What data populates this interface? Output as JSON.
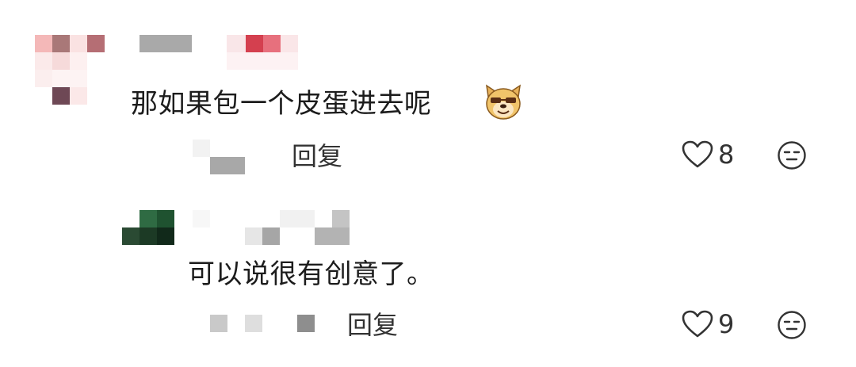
{
  "comments": [
    {
      "text": "那如果包一个皮蛋进去呢",
      "emoji_icon": "doge-sunglasses-emoji-icon",
      "reply_label": "回复",
      "like_count": "8",
      "like_icon": "heart-outline-icon",
      "dislike_icon": "neutral-face-icon",
      "avatar_colors": [
        "#f3c7c7",
        "#a87272",
        "#f7dede",
        "#6e4a55"
      ]
    },
    {
      "text": "可以说很有创意了。",
      "reply_label": "回复",
      "like_count": "9",
      "like_icon": "heart-outline-icon",
      "dislike_icon": "neutral-face-icon",
      "avatar_colors": [
        "#2d5a3a",
        "#1d4a2a",
        "#13301b"
      ]
    }
  ]
}
